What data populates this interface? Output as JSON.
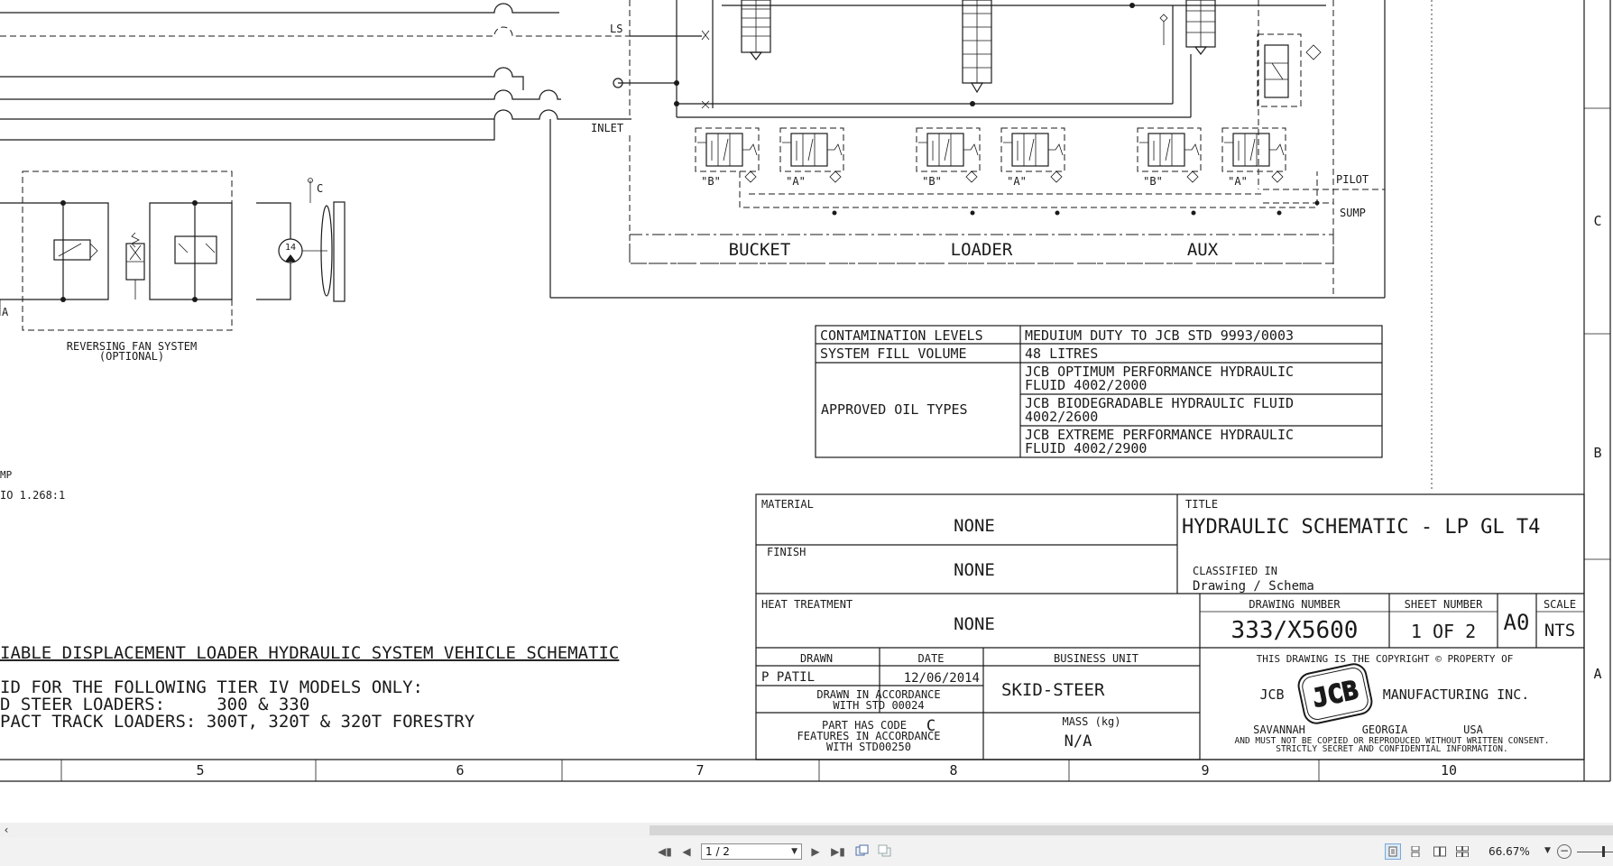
{
  "schematic": {
    "labels": {
      "ls": "LS",
      "inlet": "INLET",
      "pilot": "PILOT",
      "sump": "SUMP",
      "c_port": "C",
      "a_port": "A",
      "motor_num": "14",
      "mp_fragment": "MP",
      "ratio_fragment": "IO 1.268:1"
    },
    "valve_ports": [
      "\"B\"",
      "\"A\"",
      "\"B\"",
      "\"A\"",
      "\"B\"",
      "\"A\""
    ],
    "sections": [
      "BUCKET",
      "LOADER",
      "AUX"
    ],
    "fan_system": {
      "line1": "REVERSING FAN SYSTEM",
      "line2": "(OPTIONAL)"
    }
  },
  "fluid_table": {
    "contamination_label": "CONTAMINATION LEVELS",
    "contamination_value": "MEDUIUM DUTY TO JCB STD 9993/0003",
    "fill_label": "SYSTEM FILL VOLUME",
    "fill_value": "48 LITRES",
    "oil_label": "APPROVED OIL TYPES",
    "oils": [
      {
        "line1": "JCB OPTIMUM PERFORMANCE HYDRAULIC",
        "line2": "FLUID 4002/2000"
      },
      {
        "line1": "JCB BIODEGRADABLE HYDRAULIC FLUID",
        "line2": "4002/2600"
      },
      {
        "line1": "JCB EXTREME PERFORMANCE HYDRAULIC",
        "line2": "FLUID 4002/2900"
      }
    ]
  },
  "notes": {
    "title": "IABLE DISPLACEMENT LOADER HYDRAULIC SYSTEM VEHICLE SCHEMATIC",
    "line1": "ID FOR THE FOLLOWING TIER IV MODELS ONLY:",
    "line2": "D STEER LOADERS:     300 & 330",
    "line3": "PACT TRACK LOADERS: 300T, 320T & 320T FORESTRY"
  },
  "title_block": {
    "material_label": "MATERIAL",
    "material_value": "NONE",
    "finish_label": "FINISH",
    "finish_value": "NONE",
    "heat_label": "HEAT TREATMENT",
    "heat_value": "NONE",
    "title_label": "TITLE",
    "title_value": "HYDRAULIC SCHEMATIC - LP GL T4",
    "classified_label": "CLASSIFIED IN",
    "classified_value": "Drawing / Schema",
    "drawing_number_label": "DRAWING NUMBER",
    "drawing_number": "333/X5600",
    "sheet_number_label": "SHEET NUMBER",
    "sheet_number": "1 OF 2",
    "size": "A0",
    "scale_label": "SCALE",
    "scale_value": "NTS",
    "drawn_label": "DRAWN",
    "drawn_value": "P PATIL",
    "date_label": "DATE",
    "date_value": "12/06/2014",
    "business_label": "BUSINESS UNIT",
    "business_value": "SKID-STEER",
    "accordance_line1": "DRAWN IN ACCORDANCE",
    "accordance_line2": "WITH STD 00024",
    "part_code_line1": "PART HAS CODE",
    "part_code_value": "C",
    "part_code_line2": "FEATURES IN ACCORDANCE",
    "part_code_line3": "WITH STD00250",
    "mass_label": "MASS (kg)",
    "mass_value": "N/A",
    "copyright_line": "THIS DRAWING IS THE COPYRIGHT © PROPERTY OF",
    "company_left": "JCB",
    "company_right": "MANUFACTURING INC.",
    "logo_text": "JCB",
    "city": "SAVANNAH",
    "state": "GEORGIA",
    "country": "USA",
    "legal1": "AND MUST NOT BE COPIED OR REPRODUCED WITHOUT WRITTEN CONSENT.",
    "legal2": "STRICTLY SECRET AND CONFIDENTIAL INFORMATION."
  },
  "grid": {
    "columns": [
      "5",
      "6",
      "7",
      "8",
      "9",
      "10"
    ],
    "rows": [
      "C",
      "B",
      "A"
    ]
  },
  "viewer": {
    "page_field": "1 / 2",
    "zoom": "66.67%",
    "icons": [
      "first-page-icon",
      "prev-page-icon",
      "next-page-icon",
      "last-page-icon",
      "previous-view-icon",
      "next-view-icon",
      "single-page-icon",
      "continuous-icon",
      "two-page-icon",
      "two-page-continuous-icon",
      "zoom-out-icon"
    ]
  }
}
